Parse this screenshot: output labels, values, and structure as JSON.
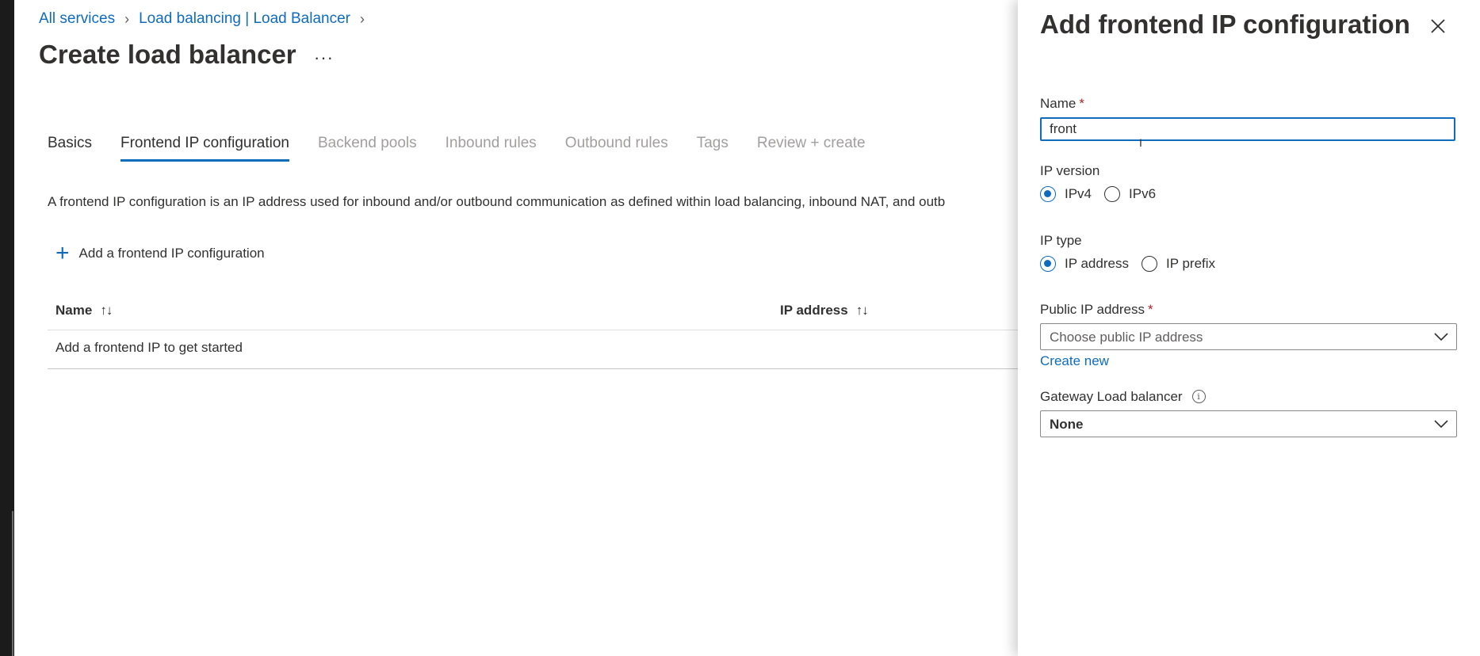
{
  "breadcrumb": {
    "items": [
      "All services",
      "Load balancing | Load Balancer"
    ]
  },
  "page": {
    "title": "Create load balancer",
    "more": "···"
  },
  "tabs": [
    {
      "label": "Basics",
      "state": "enabled"
    },
    {
      "label": "Frontend IP configuration",
      "state": "active"
    },
    {
      "label": "Backend pools",
      "state": "disabled"
    },
    {
      "label": "Inbound rules",
      "state": "disabled"
    },
    {
      "label": "Outbound rules",
      "state": "disabled"
    },
    {
      "label": "Tags",
      "state": "disabled"
    },
    {
      "label": "Review + create",
      "state": "disabled"
    }
  ],
  "description": "A frontend IP configuration is an IP address used for inbound and/or outbound communication as defined within load balancing, inbound NAT, and outb",
  "add_action": {
    "label": "Add a frontend IP configuration"
  },
  "grid": {
    "columns": [
      "Name",
      "IP address"
    ],
    "sort_icon": "↑↓",
    "empty_text": "Add a frontend IP to get started"
  },
  "panel": {
    "title": "Add frontend IP configuration",
    "name_label": "Name",
    "required_marker": "*",
    "name_value": "front",
    "ip_version": {
      "label": "IP version",
      "options": [
        "IPv4",
        "IPv6"
      ],
      "selected": "IPv4"
    },
    "ip_type": {
      "label": "IP type",
      "options": [
        "IP address",
        "IP prefix"
      ],
      "selected": "IP address"
    },
    "public_ip": {
      "label": "Public IP address",
      "placeholder": "Choose public IP address",
      "create_new": "Create new"
    },
    "gateway": {
      "label": "Gateway Load balancer",
      "info_icon": "i",
      "value": "None"
    }
  },
  "colors": {
    "accent": "#0f6cbd",
    "required": "#a4262c",
    "text": "#323130",
    "disabled": "#a19f9d"
  }
}
